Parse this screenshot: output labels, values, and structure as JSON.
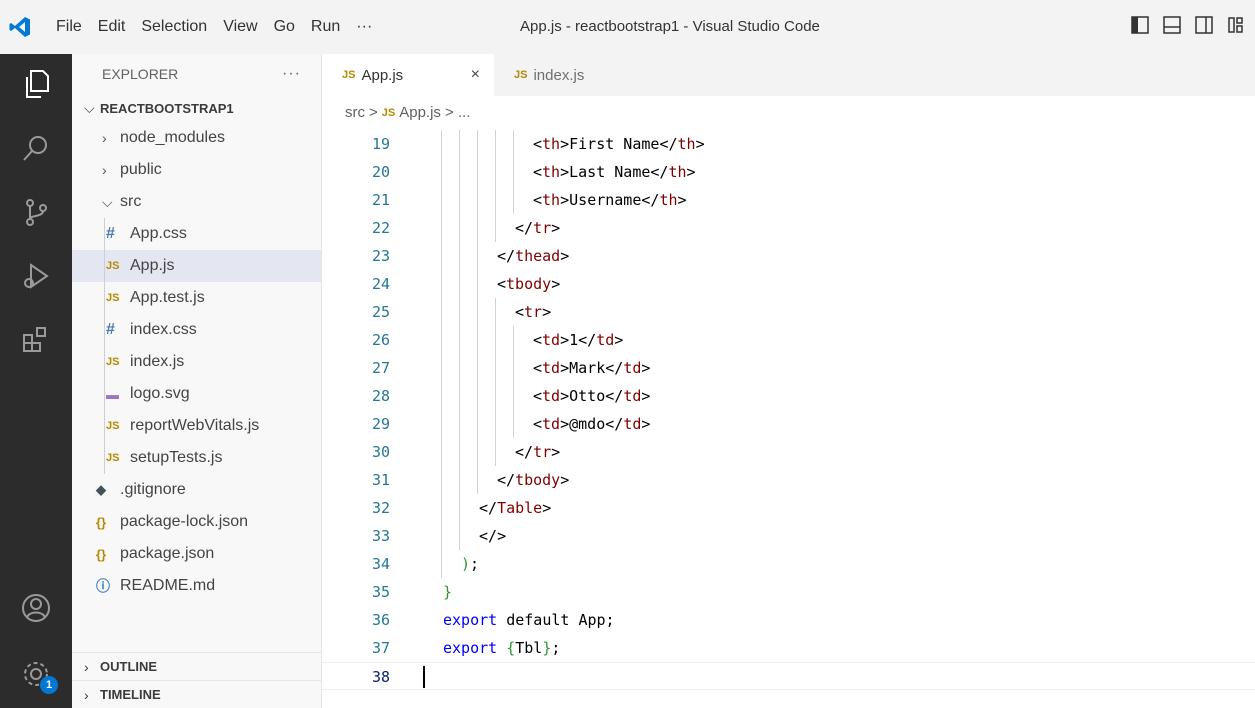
{
  "menu": [
    "File",
    "Edit",
    "Selection",
    "View",
    "Go",
    "Run",
    "···"
  ],
  "window_title": "App.js - reactbootstrap1 - Visual Studio Code",
  "explorer": {
    "title": "EXPLORER",
    "more": "···",
    "project": "REACTBOOTSTRAP1",
    "items": [
      {
        "label": "node_modules",
        "type": "folder",
        "expanded": false
      },
      {
        "label": "public",
        "type": "folder",
        "expanded": false
      },
      {
        "label": "src",
        "type": "folder",
        "expanded": true
      },
      {
        "label": "App.css",
        "type": "css"
      },
      {
        "label": "App.js",
        "type": "js",
        "selected": true
      },
      {
        "label": "App.test.js",
        "type": "js"
      },
      {
        "label": "index.css",
        "type": "css"
      },
      {
        "label": "index.js",
        "type": "js"
      },
      {
        "label": "logo.svg",
        "type": "svg"
      },
      {
        "label": "reportWebVitals.js",
        "type": "js"
      },
      {
        "label": "setupTests.js",
        "type": "js"
      },
      {
        "label": ".gitignore",
        "type": "git"
      },
      {
        "label": "package-lock.json",
        "type": "json"
      },
      {
        "label": "package.json",
        "type": "json"
      },
      {
        "label": "README.md",
        "type": "info"
      }
    ],
    "outline": "OUTLINE",
    "timeline": "TIMELINE"
  },
  "tabs": [
    {
      "label": "App.js",
      "icon": "JS",
      "active": true,
      "close": "×"
    },
    {
      "label": "index.js",
      "icon": "JS",
      "active": false
    }
  ],
  "breadcrumb": {
    "folder": "src",
    "sep": ">",
    "icon": "JS",
    "file": "App.js",
    "more": "> ..."
  },
  "activity": {
    "settings_badge": "1"
  },
  "code": [
    {
      "n": "19",
      "text": "<th>First Name</th>"
    },
    {
      "n": "20",
      "text": "<th>Last Name</th>"
    },
    {
      "n": "21",
      "text": "<th>Username</th>"
    },
    {
      "n": "22",
      "text": "</tr>"
    },
    {
      "n": "23",
      "text": "</thead>"
    },
    {
      "n": "24",
      "text": "<tbody>"
    },
    {
      "n": "25",
      "text": "<tr>"
    },
    {
      "n": "26",
      "text": "<td>1</td>"
    },
    {
      "n": "27",
      "text": "<td>Mark</td>"
    },
    {
      "n": "28",
      "text": "<td>Otto</td>"
    },
    {
      "n": "29",
      "text": "<td>@mdo</td>"
    },
    {
      "n": "30",
      "text": "</tr>"
    },
    {
      "n": "31",
      "text": "</tbody>"
    },
    {
      "n": "32",
      "text": "</Table>"
    },
    {
      "n": "33",
      "text": "</>"
    },
    {
      "n": "34",
      "text": ");"
    },
    {
      "n": "35",
      "text": "}"
    },
    {
      "n": "36",
      "text": "export default App;"
    },
    {
      "n": "37",
      "text": "export {Tbl};"
    },
    {
      "n": "38",
      "text": ""
    }
  ],
  "colors": {
    "accent": "#0078d4",
    "tag": "#800000",
    "keyword": "#0000ff",
    "line_number": "#237893"
  }
}
